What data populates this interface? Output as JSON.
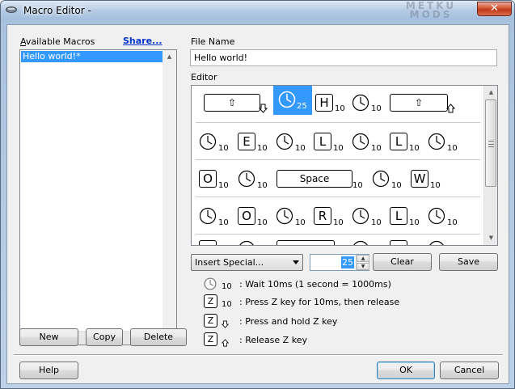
{
  "window": {
    "title": "Macro Editor - ",
    "watermark": "METKU MODS",
    "close_glyph": "✕"
  },
  "macros": {
    "label": "Available Macros",
    "share_label": "Share...",
    "items": [
      {
        "label": "Hello world!*"
      }
    ],
    "new_label": "New",
    "copy_label": "Copy",
    "delete_label": "Delete"
  },
  "file_name": {
    "label": "File Name",
    "value": "Hello world!"
  },
  "editor": {
    "label": "Editor",
    "rows": [
      {
        "letters": [
          "H"
        ],
        "waits": [
          "25",
          "10",
          "10"
        ],
        "shift_label": "⇧",
        "selected_wait": "25"
      },
      {
        "letters": [
          "E",
          "L",
          "L"
        ],
        "waits": [
          "10",
          "10",
          "10",
          "10",
          "10",
          "10",
          "10"
        ]
      },
      {
        "letters": [
          "O",
          "W"
        ],
        "waits": [
          "10",
          "10",
          "10",
          "10",
          "10"
        ],
        "space_label": "Space"
      },
      {
        "letters": [
          "O",
          "R",
          "L"
        ],
        "waits": [
          "10",
          "10",
          "10",
          "10",
          "10",
          "10",
          "10"
        ]
      }
    ]
  },
  "controls": {
    "insert_special": "Insert Special...",
    "delay_value": "25",
    "clear_label": "Clear",
    "save_label": "Save"
  },
  "legend": {
    "wait": {
      "num": "10",
      "text": ": Wait 10ms (1 second = 1000ms)"
    },
    "press": {
      "key": "Z",
      "num": "10",
      "text": ": Press Z key for 10ms, then release"
    },
    "hold": {
      "key": "Z",
      "text": ": Press and hold Z key"
    },
    "release": {
      "key": "Z",
      "text": ": Release Z key"
    }
  },
  "footer": {
    "help_label": "Help",
    "ok_label": "OK",
    "cancel_label": "Cancel"
  },
  "colors": {
    "selection": "#3399ff",
    "link": "#0033cc",
    "close_button": "#c0391a"
  }
}
